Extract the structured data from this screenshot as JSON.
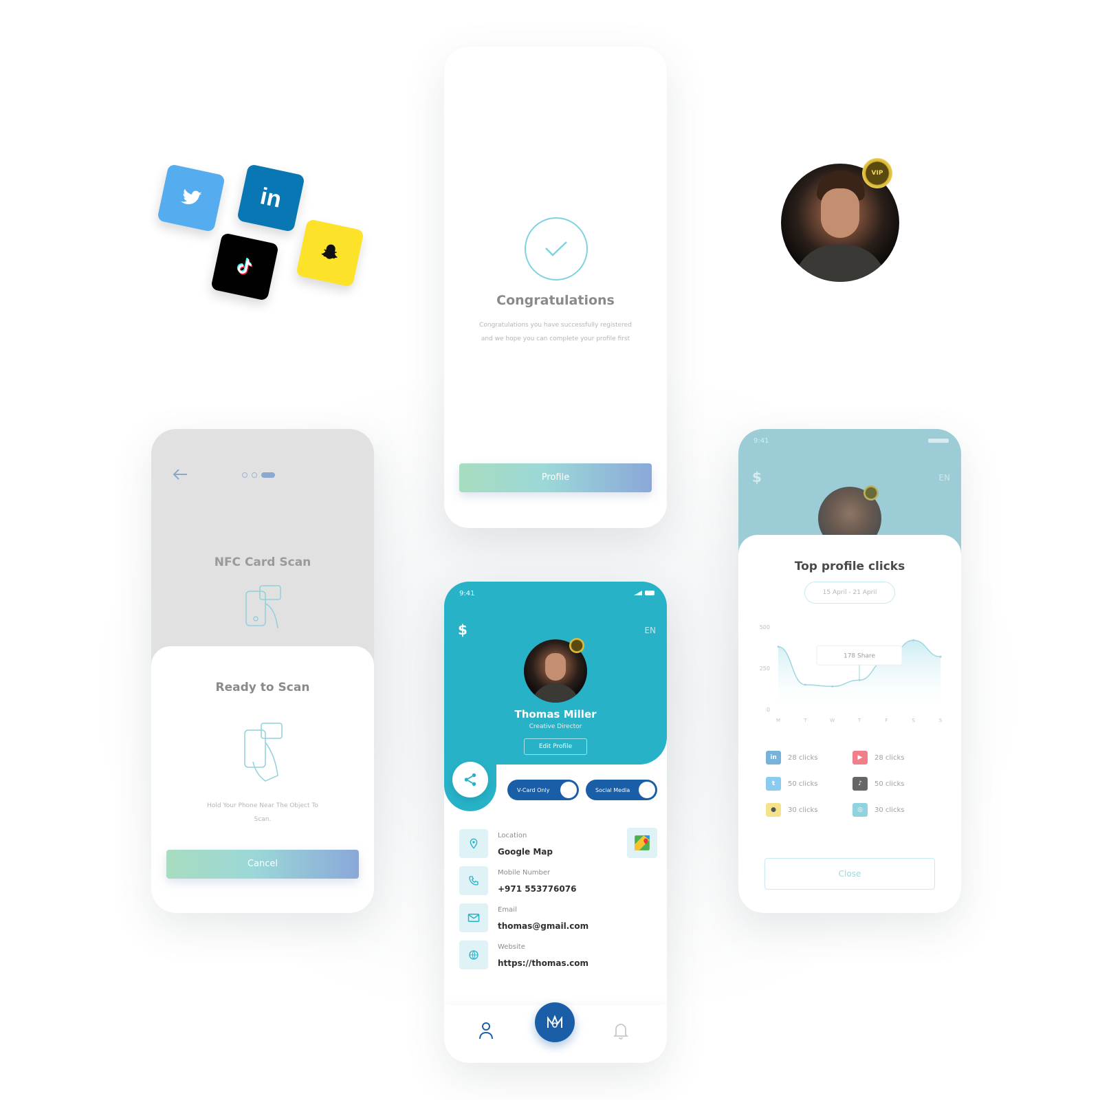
{
  "social_tiles": [
    {
      "icon": "twitter-icon",
      "color": "#55acee",
      "glyph": "🐦"
    },
    {
      "icon": "linkedin-icon",
      "color": "#0a77b5",
      "glyph": "in"
    },
    {
      "icon": "tiktok-icon",
      "color": "#010101",
      "glyph": "♪"
    },
    {
      "icon": "snapchat-icon",
      "color": "#fde22a",
      "glyph": "👻"
    }
  ],
  "vip_badge": "VIP",
  "congrats": {
    "title": "Congratulations",
    "body": "Congratulations you have successfully registered and we hope you can complete your profile first",
    "button": "Profile"
  },
  "nfc": {
    "title": "NFC Card Scan",
    "sheet_title": "Ready to Scan",
    "instruction": "Hold Your Phone Near The Object To Scan.",
    "cancel": "Cancel"
  },
  "profile": {
    "time": "9:41",
    "currency_icon": "$",
    "lang": "EN",
    "name": "Thomas Miller",
    "role": "Creative Director",
    "edit_button": "Edit Profile",
    "toggle_vcard": "V-Card Only",
    "toggle_social": "Social Media",
    "rows": [
      {
        "label": "Location",
        "value": "Google Map",
        "icon": "location-pin-icon"
      },
      {
        "label": "Mobile Number",
        "value": "+971 553776076",
        "icon": "phone-icon"
      },
      {
        "label": "Email",
        "value": "thomas@gmail.com",
        "icon": "mail-icon"
      },
      {
        "label": "Website",
        "value": "https://thomas.com",
        "icon": "globe-icon"
      }
    ],
    "accent": "#27b2c8"
  },
  "stats": {
    "time": "9:41",
    "currency_icon": "$",
    "lang": "EN",
    "title": "Top profile clicks",
    "date_range": "15 April - 21 April",
    "tooltip": "178 Share",
    "close": "Close",
    "items_left": [
      {
        "icon": "linkedin-icon",
        "color": "#77b3d8",
        "label": "28 clicks"
      },
      {
        "icon": "twitter-icon",
        "color": "#8ccbf0",
        "label": "50 clicks"
      },
      {
        "icon": "snapchat-icon",
        "color": "#f5e38c",
        "label": "30 clicks"
      }
    ],
    "items_right": [
      {
        "icon": "youtube-icon",
        "color": "#f07f8a",
        "label": "28 clicks"
      },
      {
        "icon": "tiktok-icon",
        "color": "#666666",
        "label": "50 clicks"
      },
      {
        "icon": "globe-icon",
        "color": "#8fd3de",
        "label": "30 clicks"
      }
    ]
  },
  "chart_data": {
    "type": "area",
    "x": [
      "M",
      "T",
      "W",
      "T",
      "F",
      "S",
      "S"
    ],
    "yticks": [
      "500",
      "250",
      "0"
    ],
    "ylim": [
      0,
      500
    ],
    "values": [
      380,
      150,
      140,
      178,
      300,
      420,
      320
    ],
    "color": "#bfe8ef",
    "title": "",
    "xlabel": "",
    "ylabel": ""
  }
}
